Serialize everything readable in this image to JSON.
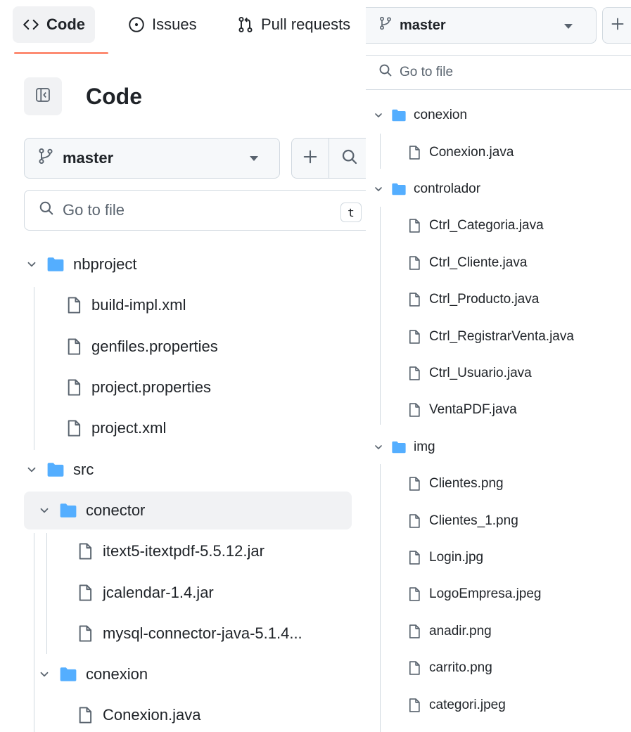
{
  "left": {
    "tabs": {
      "code": "Code",
      "issues": "Issues",
      "pulls": "Pull requests"
    },
    "title": "Code",
    "branch": "master",
    "search_placeholder": "Go to file",
    "search_shortcut": "t",
    "tree": [
      {
        "type": "folder",
        "name": "nbproject"
      },
      {
        "type": "file",
        "name": "build-impl.xml"
      },
      {
        "type": "file",
        "name": "genfiles.properties"
      },
      {
        "type": "file",
        "name": "project.properties"
      },
      {
        "type": "file",
        "name": "project.xml"
      },
      {
        "type": "folder",
        "name": "src"
      },
      {
        "type": "folder",
        "name": "conector",
        "selected": true
      },
      {
        "type": "file",
        "name": "itext5-itextpdf-5.5.12.jar"
      },
      {
        "type": "file",
        "name": "jcalendar-1.4.jar"
      },
      {
        "type": "file",
        "name": "mysql-connector-java-5.1.4..."
      },
      {
        "type": "folder",
        "name": "conexion"
      },
      {
        "type": "file",
        "name": "Conexion.java"
      }
    ]
  },
  "right": {
    "branch": "master",
    "search_placeholder": "Go to file",
    "tree": [
      {
        "type": "folder",
        "name": "conexion"
      },
      {
        "type": "file",
        "name": "Conexion.java"
      },
      {
        "type": "folder",
        "name": "controlador"
      },
      {
        "type": "file",
        "name": "Ctrl_Categoria.java"
      },
      {
        "type": "file",
        "name": "Ctrl_Cliente.java"
      },
      {
        "type": "file",
        "name": "Ctrl_Producto.java"
      },
      {
        "type": "file",
        "name": "Ctrl_RegistrarVenta.java"
      },
      {
        "type": "file",
        "name": "Ctrl_Usuario.java"
      },
      {
        "type": "file",
        "name": "VentaPDF.java"
      },
      {
        "type": "folder",
        "name": "img"
      },
      {
        "type": "file",
        "name": "Clientes.png"
      },
      {
        "type": "file",
        "name": "Clientes_1.png"
      },
      {
        "type": "file",
        "name": "Login.jpg"
      },
      {
        "type": "file",
        "name": "LogoEmpresa.jpeg"
      },
      {
        "type": "file",
        "name": "anadir.png"
      },
      {
        "type": "file",
        "name": "carrito.png"
      },
      {
        "type": "file",
        "name": "categori.jpeg"
      }
    ]
  },
  "colors": {
    "folder": "#54aeff",
    "accent_underline": "#fd8c73",
    "selected_bg": "#f1f2f4"
  }
}
